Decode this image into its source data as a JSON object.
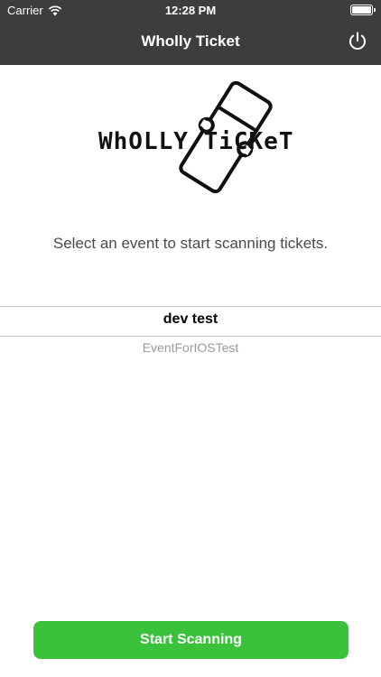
{
  "status_bar": {
    "carrier": "Carrier",
    "time": "12:28 PM",
    "wifi_icon": "wifi-icon",
    "battery_icon": "battery-icon"
  },
  "nav": {
    "title": "Wholly Ticket",
    "power_icon": "power-icon"
  },
  "logo": {
    "text": "WhOLLY TiCKeT"
  },
  "prompt": "Select an event to start  scanning tickets.",
  "events": {
    "selected": "dev test",
    "next": "EventForIOSTest"
  },
  "actions": {
    "start_label": "Start Scanning"
  },
  "colors": {
    "nav_bg": "#3d3d3d",
    "accent_green": "#39c23a"
  }
}
